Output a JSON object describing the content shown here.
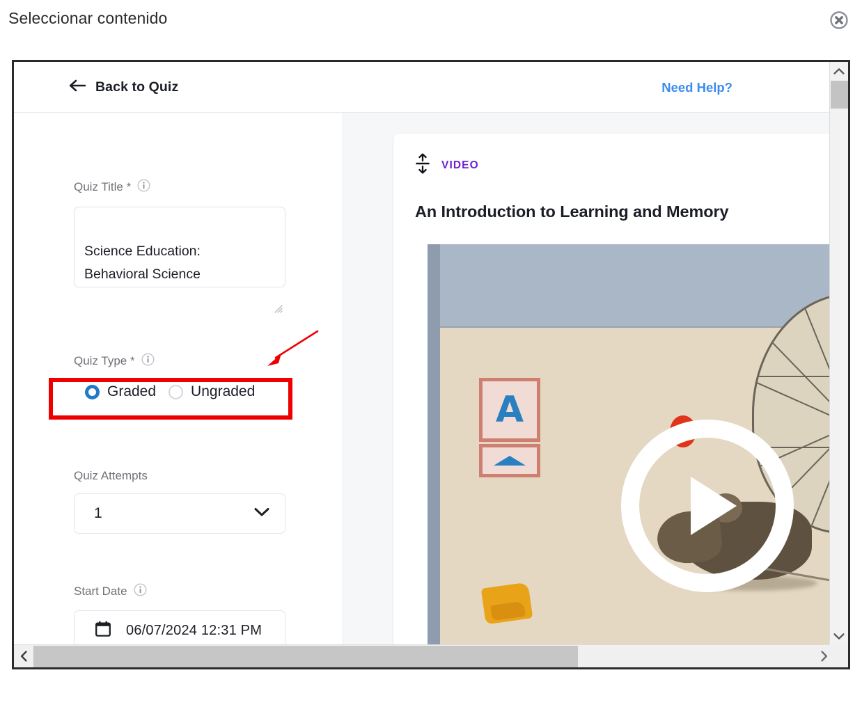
{
  "page": {
    "title": "Seleccionar contenido",
    "close_icon": "close-circle-x-icon"
  },
  "appbar": {
    "back_label": "Back to Quiz",
    "back_icon": "arrow-left-icon",
    "help_label": "Need Help?"
  },
  "form": {
    "quiz_title": {
      "label": "Quiz Title *",
      "info_icon": "info-circle-icon",
      "value": "Science Education:\nBehavioral Science"
    },
    "quiz_type": {
      "label": "Quiz Type *",
      "info_icon": "info-circle-icon",
      "options": [
        {
          "label": "Graded",
          "selected": true
        },
        {
          "label": "Ungraded",
          "selected": false
        }
      ]
    },
    "quiz_attempts": {
      "label": "Quiz Attempts",
      "value": "1",
      "chevron_icon": "chevron-down-icon"
    },
    "start_date": {
      "label": "Start Date",
      "info_icon": "info-circle-icon",
      "calendar_icon": "calendar-icon",
      "value": "06/07/2024 12:31 PM"
    }
  },
  "content_card": {
    "kicker": "VIDEO",
    "drag_icon": "drag-vertical-handle-icon",
    "title": "An Introduction to Learning and Memory",
    "play_icon": "play-button-icon",
    "poster_letter": "A"
  },
  "scrollbars": {
    "vertical": {
      "up_icon": "chevron-up-icon",
      "down_icon": "chevron-down-icon"
    },
    "horizontal": {
      "left_icon": "chevron-left-icon",
      "right_icon": "chevron-right-icon"
    }
  },
  "annotations": {
    "highlight_color": "#ee0000",
    "arrow_target": "quiz-type-radio-group"
  },
  "colors": {
    "link_blue": "#3b8cf0",
    "radio_blue": "#1f7ac7",
    "kicker_purple": "#6b21d6",
    "annotation_red": "#ee0000"
  }
}
